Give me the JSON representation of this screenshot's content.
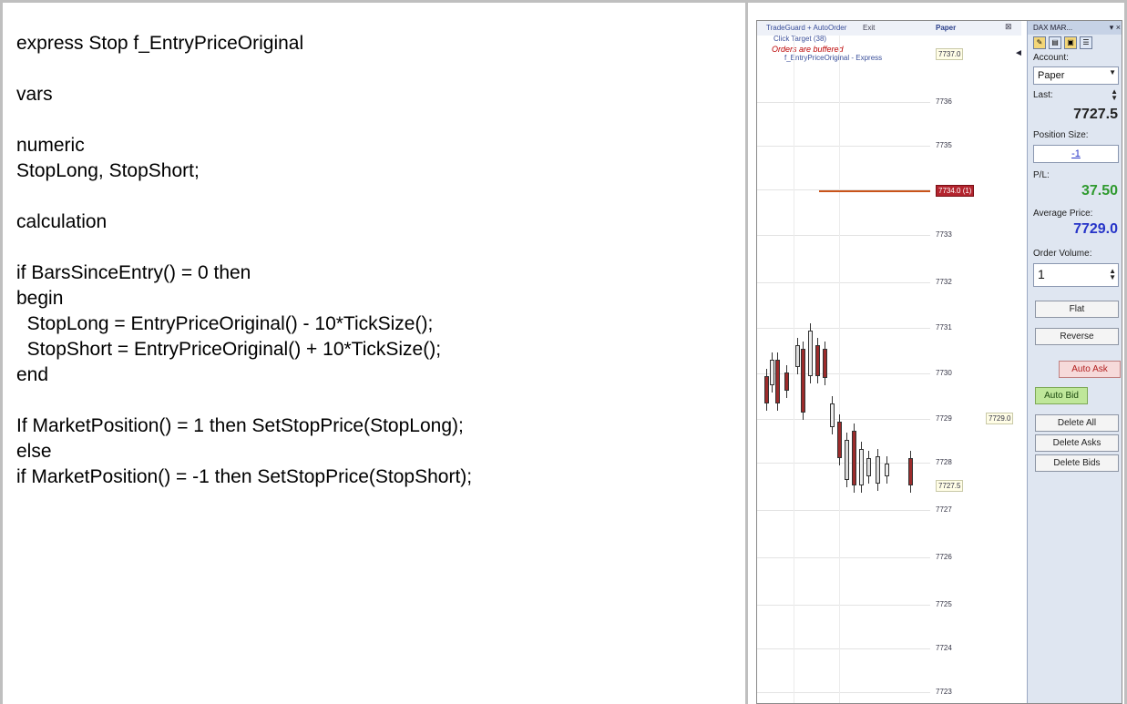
{
  "code": {
    "lines": [
      "express Stop f_EntryPriceOriginal",
      "",
      "vars",
      "",
      "numeric",
      "StopLong, StopShort;",
      "",
      "calculation",
      "",
      "if BarsSinceEntry() = 0 then",
      "begin",
      "  StopLong = EntryPriceOriginal() - 10*TickSize();",
      "  StopShort = EntryPriceOriginal() + 10*TickSize();",
      "end",
      "",
      "If MarketPosition() = 1 then SetStopPrice(StopLong);",
      "else",
      "if MarketPosition() = -1 then SetStopPrice(StopShort);"
    ]
  },
  "chart": {
    "header_left": "TradeGuard + AutoOrder",
    "header_mid": "Exit",
    "header_account": "Paper",
    "sub_click_target": "Click Target (38)",
    "sub_buffered": "Orders are buffered",
    "sub_indicator": "f_EntryPriceOriginal - Express",
    "price_labels": [
      "7737.0",
      "7736",
      "7735",
      "7734",
      "7733",
      "7732",
      "7731",
      "7730",
      "7729",
      "7728",
      "7727",
      "7726",
      "7725",
      "7724",
      "7723"
    ],
    "tag_top": "7737.0",
    "tag_stop": "7734.0 (1)",
    "tag_entry": "7729.0",
    "tag_last": "7727.5",
    "arrow": "◄"
  },
  "panel": {
    "title": "DAX MAR...",
    "title_icons": "▾ ×",
    "account_label": "Account:",
    "account_value": "Paper",
    "last_label": "Last:",
    "last_value": "7727.5",
    "position_size_label": "Position Size:",
    "position_size_value": "-1",
    "pl_label": "P/L:",
    "pl_value": "37.50",
    "avg_price_label": "Average Price:",
    "avg_price_value": "7729.0",
    "order_volume_label": "Order Volume:",
    "order_volume_value": "1",
    "buttons": {
      "flat": "Flat",
      "reverse": "Reverse",
      "auto_ask": "Auto Ask",
      "auto_bid": "Auto Bid",
      "delete_all": "Delete All",
      "delete_asks": "Delete Asks",
      "delete_bids": "Delete Bids"
    },
    "colors": {
      "pl": "#2f9a2f",
      "avg_price": "#2634c8",
      "auto_ask": "#b32020",
      "auto_bid_bg": "#bfe79a"
    }
  }
}
